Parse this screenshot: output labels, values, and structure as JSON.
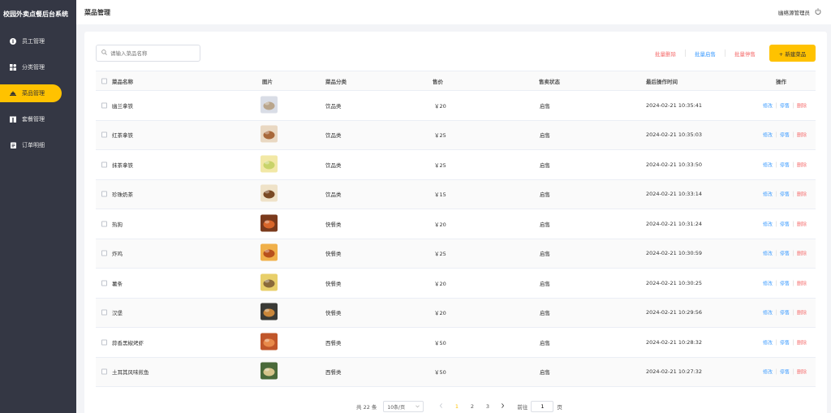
{
  "app": {
    "title": "校园外卖点餐后台系统"
  },
  "sidebar": {
    "items": [
      {
        "label": "员工管理",
        "icon": "employee-icon",
        "active": false
      },
      {
        "label": "分类管理",
        "icon": "category-icon",
        "active": false
      },
      {
        "label": "菜品管理",
        "icon": "dish-icon",
        "active": true
      },
      {
        "label": "套餐管理",
        "icon": "setmeal-icon",
        "active": false
      },
      {
        "label": "订单明细",
        "icon": "order-icon",
        "active": false
      }
    ]
  },
  "header": {
    "title": "菜品管理",
    "user": "幽络源管理员",
    "logout_icon": "power-icon"
  },
  "toolbar": {
    "search_placeholder": "请输入菜品名称",
    "batch_delete": "批量删除",
    "batch_enable": "批量启售",
    "batch_disable": "批量停售",
    "new_button": "+ 新建菜品"
  },
  "table": {
    "columns": [
      "菜品名称",
      "图片",
      "菜品分类",
      "售价",
      "售卖状态",
      "最后操作时间",
      "操作"
    ],
    "rows": [
      {
        "name": "幽兰拿铁",
        "category": "饮品类",
        "price": "￥20",
        "status": "启售",
        "time": "2024-02-21 10:35:41",
        "img": "drink-latte"
      },
      {
        "name": "红茶拿铁",
        "category": "饮品类",
        "price": "￥25",
        "status": "启售",
        "time": "2024-02-21 10:35:03",
        "img": "drink-tea"
      },
      {
        "name": "抹茶拿铁",
        "category": "饮品类",
        "price": "￥25",
        "status": "启售",
        "time": "2024-02-21 10:33:50",
        "img": "drink-matcha"
      },
      {
        "name": "珍珠奶茶",
        "category": "饮品类",
        "price": "￥15",
        "status": "启售",
        "time": "2024-02-21 10:33:14",
        "img": "drink-boba"
      },
      {
        "name": "热狗",
        "category": "快餐类",
        "price": "￥20",
        "status": "启售",
        "time": "2024-02-21 10:31:24",
        "img": "food-hotdog"
      },
      {
        "name": "炸鸡",
        "category": "快餐类",
        "price": "￥25",
        "status": "启售",
        "time": "2024-02-21 10:30:59",
        "img": "food-chicken"
      },
      {
        "name": "薯条",
        "category": "快餐类",
        "price": "￥20",
        "status": "启售",
        "time": "2024-02-21 10:30:25",
        "img": "food-fries"
      },
      {
        "name": "汉堡",
        "category": "快餐类",
        "price": "￥20",
        "status": "启售",
        "time": "2024-02-21 10:29:56",
        "img": "food-burger"
      },
      {
        "name": "蒜香黑椒烤虾",
        "category": "西餐类",
        "price": "￥50",
        "status": "启售",
        "time": "2024-02-21 10:28:32",
        "img": "food-shrimp"
      },
      {
        "name": "土耳其风味煎鱼",
        "category": "西餐类",
        "price": "￥50",
        "status": "启售",
        "time": "2024-02-21 10:27:32",
        "img": "food-fish"
      }
    ],
    "ops": {
      "edit": "修改",
      "disable": "停售",
      "delete": "删除"
    }
  },
  "pager": {
    "total": "共 22 条",
    "page_size": "10条/页",
    "pages": [
      "1",
      "2",
      "3"
    ],
    "current": "1",
    "goto_label": "前往",
    "goto_value": "1",
    "page_unit": "页"
  },
  "colors": {
    "accent": "#ffc200",
    "sidebar_bg": "#343744",
    "link_blue": "#419eff",
    "danger_red": "#f56c6c"
  }
}
